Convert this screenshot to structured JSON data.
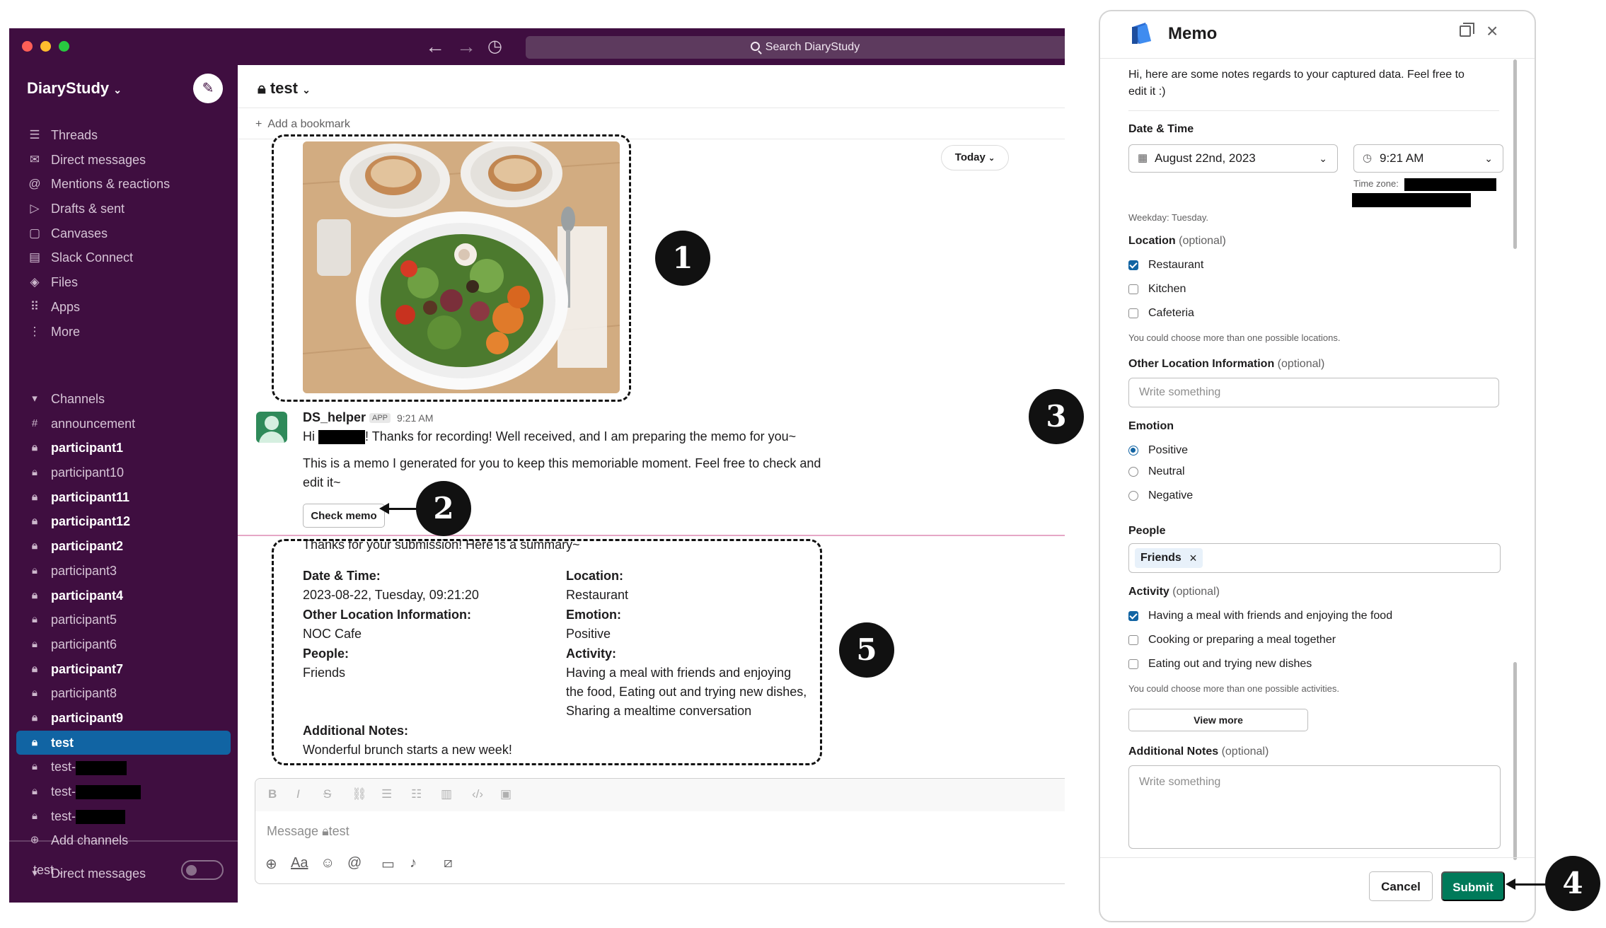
{
  "window": {
    "search_placeholder": "Search DiaryStudy"
  },
  "sidebar": {
    "workspace": "DiaryStudy",
    "nav": [
      {
        "label": "Threads",
        "icon": "threads-icon"
      },
      {
        "label": "Direct messages",
        "icon": "dm-icon"
      },
      {
        "label": "Mentions & reactions",
        "icon": "at-icon"
      },
      {
        "label": "Drafts & sent",
        "icon": "send-icon"
      },
      {
        "label": "Canvases",
        "icon": "canvas-icon"
      },
      {
        "label": "Slack Connect",
        "icon": "building-icon"
      },
      {
        "label": "Files",
        "icon": "files-icon"
      },
      {
        "label": "Apps",
        "icon": "apps-icon"
      },
      {
        "label": "More",
        "icon": "more-icon"
      }
    ],
    "channels_header": "Channels",
    "channels": [
      {
        "label": "announcement",
        "bold": false,
        "public": true
      },
      {
        "label": "participant1",
        "bold": true
      },
      {
        "label": "participant10",
        "bold": false
      },
      {
        "label": "participant11",
        "bold": true
      },
      {
        "label": "participant12",
        "bold": true
      },
      {
        "label": "participant2",
        "bold": true
      },
      {
        "label": "participant3",
        "bold": false
      },
      {
        "label": "participant4",
        "bold": true
      },
      {
        "label": "participant5",
        "bold": false
      },
      {
        "label": "participant6",
        "bold": false
      },
      {
        "label": "participant7",
        "bold": true
      },
      {
        "label": "participant8",
        "bold": false
      },
      {
        "label": "participant9",
        "bold": true
      },
      {
        "label": "test",
        "bold": true,
        "active": true
      },
      {
        "label": "test-",
        "bold": false,
        "redacted": true
      },
      {
        "label": "test-",
        "bold": false,
        "redacted": true
      },
      {
        "label": "test-",
        "bold": false,
        "redacted": true
      }
    ],
    "add_channels": "Add channels",
    "dm_header": "Direct messages",
    "footer_user": "test"
  },
  "channel": {
    "name": "test",
    "add_bookmark": "Add a bookmark",
    "today": "Today",
    "message": {
      "sender": "DS_helper",
      "badge": "APP",
      "time": "9:21 AM",
      "line1_pre": "Hi",
      "line1_post": "! Thanks for recording! Well received, and I am preparing the memo for you~",
      "line2": "This is a memo I generated for you to keep this memoriable moment. Feel free to check and",
      "line3": "edit it~",
      "check_memo": "Check memo"
    },
    "summary": {
      "intro": "Thanks for your submission! Here is a summary~",
      "date_label": "Date & Time:",
      "date_value": "2023-08-22, Tuesday, 09:21:20",
      "other_loc_label": "Other Location Information:",
      "other_loc_value": "NOC Cafe",
      "people_label": "People:",
      "people_value": "Friends",
      "location_label": "Location:",
      "location_value": "Restaurant",
      "emotion_label": "Emotion:",
      "emotion_value": "Positive",
      "activity_label": "Activity:",
      "activity_line1": "Having a meal with friends and enjoying",
      "activity_line2": "the food, Eating out and trying new dishes,",
      "activity_line3": "Sharing a mealtime conversation",
      "notes_label": "Additional Notes:",
      "notes_value": "Wonderful brunch starts a new week!"
    },
    "composer_placeholder": "Message",
    "composer_channel": "test"
  },
  "memo": {
    "title": "Memo",
    "intro_line1": "Hi, here are some notes regards to your captured data. Feel free to",
    "intro_line2": "edit it :)",
    "date_time_label": "Date & Time",
    "date_value": "August 22nd, 2023",
    "time_value": "9:21 AM",
    "timezone_label": "Time zone:",
    "weekday": "Weekday: Tuesday.",
    "location_label": "Location",
    "optional": "(optional)",
    "locations": [
      {
        "label": "Restaurant",
        "checked": true
      },
      {
        "label": "Kitchen",
        "checked": false
      },
      {
        "label": "Cafeteria",
        "checked": false
      }
    ],
    "location_hint": "You could choose more than one possible locations.",
    "other_loc_label": "Other Location Information",
    "write_something": "Write something",
    "emotion_label": "Emotion",
    "emotions": [
      {
        "label": "Positive",
        "selected": true
      },
      {
        "label": "Neutral",
        "selected": false
      },
      {
        "label": "Negative",
        "selected": false
      }
    ],
    "people_label": "People",
    "people_chip": "Friends",
    "activity_label": "Activity",
    "activities": [
      {
        "label": "Having a meal with friends and enjoying the food",
        "checked": true
      },
      {
        "label": "Cooking or preparing a meal together",
        "checked": false
      },
      {
        "label": "Eating out and trying new dishes",
        "checked": false
      }
    ],
    "activity_hint": "You could choose more than one possible activities.",
    "view_more": "View more",
    "notes_label": "Additional Notes",
    "cancel": "Cancel",
    "submit": "Submit"
  },
  "callouts": [
    "1",
    "2",
    "3",
    "4",
    "5"
  ],
  "colors": {
    "aubergine": "#3f0e40",
    "active_channel": "#1164a3",
    "submit_green": "#007a5a",
    "checkbox_blue": "#1264a3"
  }
}
